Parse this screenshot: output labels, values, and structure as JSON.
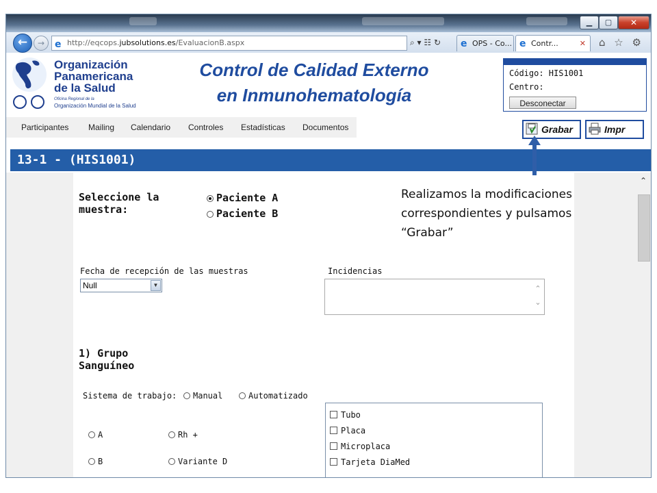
{
  "browser": {
    "url_prefix": "http://eqcops.",
    "url_host": "jubsolutions.es",
    "url_path": "/EvaluacionB.aspx",
    "address_tools": "⌕ ▾ ☷ ↻",
    "tabs": [
      {
        "label": "OPS - Co..."
      },
      {
        "label": "Contr...",
        "close": "✕"
      }
    ],
    "toolbar_icons": "⌂ ☆ ⚙",
    "window_buttons": {
      "minimize": "▁",
      "maximize": "▢",
      "close": "✕"
    }
  },
  "header": {
    "org_lines": [
      "Organización",
      "Panamericana",
      "de la Salud"
    ],
    "org_sub": [
      "Oficina Regional de la",
      "Organización Mundial de la Salud"
    ],
    "title_line1": "Control de Calidad Externo",
    "title_line2": "en Inmunohematología"
  },
  "login": {
    "code_label": "Código: HIS1001",
    "center_label": "Centro:",
    "logout_label": "Desconectar"
  },
  "menu": [
    "Participantes",
    "Mailing",
    "Calendario",
    "Controles",
    "Estadísticas",
    "Documentos"
  ],
  "actions": {
    "save_label": "Grabar",
    "print_label": "Impr"
  },
  "section": {
    "title": "13-1 - (HIS1001)"
  },
  "form": {
    "sample_label": "Seleccione la muestra:",
    "patient_options": [
      {
        "label": "Paciente A",
        "selected": true
      },
      {
        "label": "Paciente B",
        "selected": false
      }
    ],
    "date_label": "Fecha de recepción de las muestras",
    "date_value": "Null",
    "incidents_label": "Incidencias",
    "group_title": "1) Grupo Sanguíneo",
    "work_system_label": "Sistema de trabajo:",
    "work_system_options": [
      "Manual",
      "Automatizado"
    ],
    "group_options": [
      "A",
      "Rh +",
      "B",
      "Variante D"
    ],
    "methods": [
      "Tubo",
      "Placa",
      "Microplaca",
      "Tarjeta DiaMed"
    ]
  },
  "annotation": {
    "text_line1": "Realizamos la modificaciones",
    "text_line2": "correspondientes y pulsamos",
    "text_line3": "“Grabar”",
    "arrow_color": "#2f5ea8"
  }
}
